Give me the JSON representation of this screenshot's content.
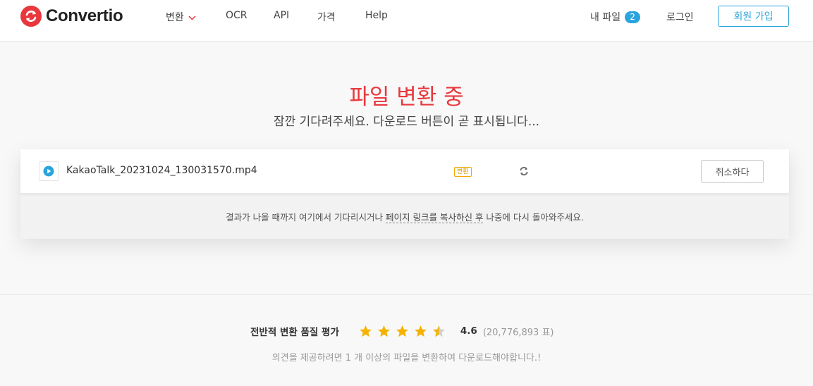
{
  "header": {
    "brand": "Convertio",
    "nav": {
      "convert": "변환",
      "ocr": "OCR",
      "api": "API",
      "pricing": "가격",
      "help": "Help"
    },
    "my_files_label": "내 파일",
    "my_files_count": "2",
    "login": "로그인",
    "signup": "회원 가입"
  },
  "main": {
    "title": "파일 변환 중",
    "subtitle": "잠깐 기다려주세요. 다운로드 버튼이 곧 표시됩니다..."
  },
  "file": {
    "name": "KakaoTalk_20231024_130031570.mp4",
    "status": "변환",
    "cancel": "취소하다"
  },
  "wait_note": {
    "before": "결과가 나올 때까지 여기에서 기다리시거나 ",
    "link": "페이지 링크를 복사하신 후",
    "after": " 나중에 다시 돌아와주세요."
  },
  "rating": {
    "label": "전반적 변환 품질 평가",
    "score": "4.6",
    "votes": "(20,776,893 표)",
    "stars_filled": 4.5,
    "stars_total": 5
  },
  "feedback_note": "의견을 제공하려면 1 개 이상의 파일을 변환하여 다운로드해야합니다.!",
  "colors": {
    "brand_red": "#e8383d",
    "accent_blue": "#2aa4dd",
    "star": "#f5b300",
    "badge_orange": "#f0a800"
  }
}
